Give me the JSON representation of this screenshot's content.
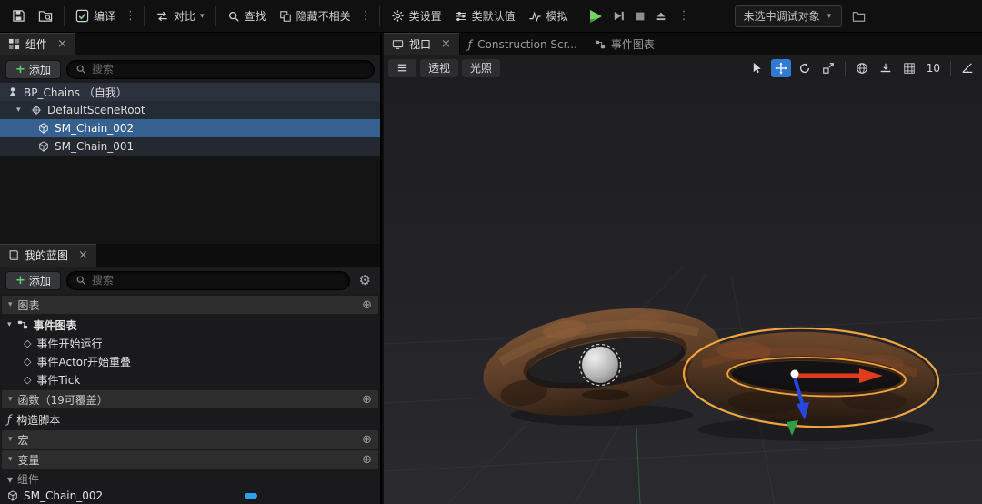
{
  "colors": {
    "selection_blue": "#35608f",
    "active_tool_blue": "#2f7ad2",
    "play_green": "#71d462",
    "selection_outline_orange": "#f2a33c",
    "gizmo_red": "#e03c1c",
    "gizmo_blue": "#2448e0",
    "gizmo_green": "#2f9e44"
  },
  "icons": {
    "close": "×",
    "kebab": "⋮",
    "chevron_down": "▾",
    "plus": "+",
    "add_circle": "⊕",
    "gear": "⚙",
    "diamond": "◇",
    "fn": "ƒ"
  },
  "toolbar": {
    "compile": "编译",
    "diff": "对比",
    "find": "查找",
    "hide_unrelated": "隐藏不相关",
    "class_settings": "类设置",
    "class_defaults": "类默认值",
    "simulate": "模拟",
    "debug_object": "未选中调试对象"
  },
  "components": {
    "tab": "组件",
    "add": "添加",
    "search": "搜索",
    "rows": [
      {
        "label": "BP_Chains （自我）"
      },
      {
        "label": "DefaultSceneRoot"
      },
      {
        "label": "SM_Chain_002"
      },
      {
        "label": "SM_Chain_001"
      }
    ]
  },
  "my_blueprint": {
    "tab": "我的蓝图",
    "add": "添加",
    "search": "搜索",
    "sections": {
      "graphs": "图表",
      "functions": "函数（19可覆盖）",
      "macros": "宏",
      "variables": "变量"
    },
    "event_graph": "事件图表",
    "events": [
      {
        "label": "事件开始运行"
      },
      {
        "label": "事件Actor开始重叠"
      },
      {
        "label": "事件Tick"
      }
    ],
    "construction_script": "构造脚本",
    "variables_category": "组件",
    "component_variable": "SM_Chain_002"
  },
  "viewport": {
    "tabs": [
      {
        "label": "视口"
      },
      {
        "label": "Construction Scr..."
      },
      {
        "label": "事件图表"
      }
    ],
    "perspective": "透视",
    "lit": "光照",
    "grid_snap_value": "10"
  }
}
